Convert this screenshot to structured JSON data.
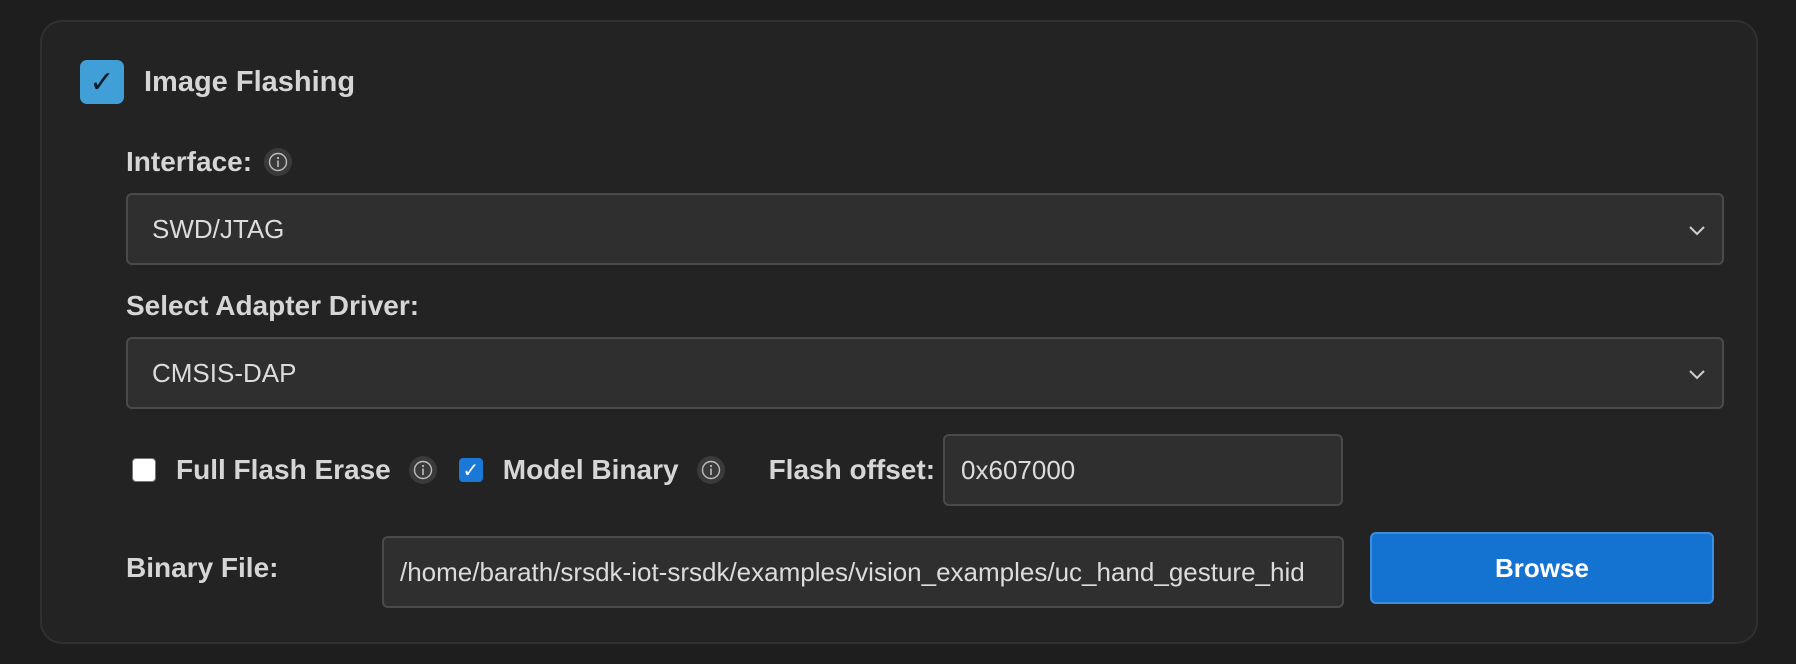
{
  "section": {
    "title": "Image Flashing",
    "enabled": true
  },
  "interface": {
    "label": "Interface:",
    "value": "SWD/JTAG"
  },
  "adapter": {
    "label": "Select Adapter Driver:",
    "value": "CMSIS-DAP"
  },
  "options": {
    "full_flash_erase": {
      "label": "Full Flash Erase",
      "checked": false
    },
    "model_binary": {
      "label": "Model Binary",
      "checked": true
    },
    "flash_offset": {
      "label": "Flash offset:",
      "value": "0x607000"
    }
  },
  "binary_file": {
    "label": "Binary File:",
    "value": "/home/barath/srsdk-iot-srsdk/examples/vision_examples/uc_hand_gesture_hid",
    "browse_label": "Browse"
  },
  "colors": {
    "accent": "#1472d1",
    "section_check": "#3f9fd6",
    "background": "#1e1e1e",
    "panel": "#232323"
  },
  "icons": {
    "info": "info-circle-icon",
    "dropdown": "chevron-down-icon",
    "check": "checkmark-icon"
  }
}
